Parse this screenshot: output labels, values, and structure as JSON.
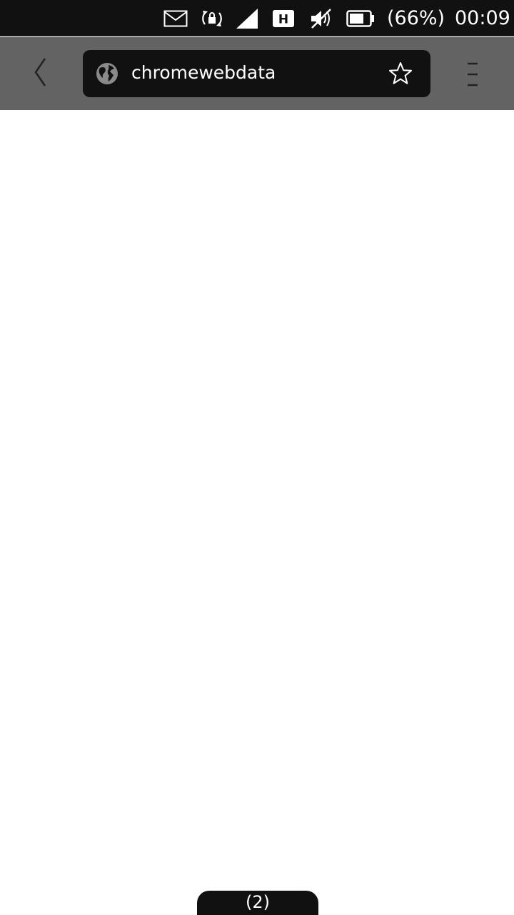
{
  "status_bar": {
    "icons": [
      "mail-icon",
      "rotation-lock-icon",
      "signal-icon",
      "network-h-icon",
      "muted-volume-icon",
      "battery-icon"
    ],
    "network_type": "H",
    "battery_percent": "(66%)",
    "time": "00:09"
  },
  "toolbar": {
    "back_icon": "chevron-left-icon",
    "url": "chromewebdata",
    "site_icon": "globe-icon",
    "bookmark_icon": "star-outline-icon",
    "menu_icon": "menu-icon"
  },
  "tabs": {
    "count_label": "(2)"
  },
  "colors": {
    "status_bar_bg": "#111111",
    "toolbar_bg": "#636363",
    "urlbar_bg": "#111111",
    "content_bg": "#ffffff"
  }
}
